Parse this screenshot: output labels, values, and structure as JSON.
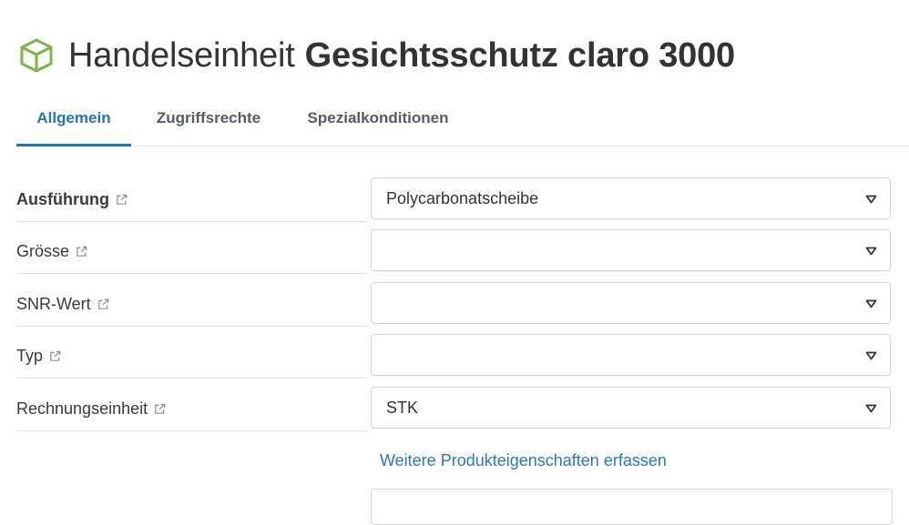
{
  "header": {
    "icon": "cube-icon",
    "icon_color": "#7ab648",
    "title_prefix": "Handelseinheit",
    "title_name": "Gesichtsschutz claro 3000"
  },
  "tabs": [
    {
      "label": "Allgemein",
      "active": true
    },
    {
      "label": "Zugriffsrechte",
      "active": false
    },
    {
      "label": "Spezialkonditionen",
      "active": false
    }
  ],
  "form": {
    "fields": [
      {
        "label": "Ausführung",
        "value": "Polycarbonatscheibe"
      },
      {
        "label": "Grösse",
        "value": ""
      },
      {
        "label": "SNR-Wert",
        "value": ""
      },
      {
        "label": "Typ",
        "value": ""
      },
      {
        "label": "Rechnungseinheit",
        "value": "STK"
      }
    ],
    "more_link": "Weitere Produkteigenschaften erfassen"
  },
  "colors": {
    "accent": "#2474bd",
    "link": "#2a78bf",
    "cube": "#7ab648"
  }
}
